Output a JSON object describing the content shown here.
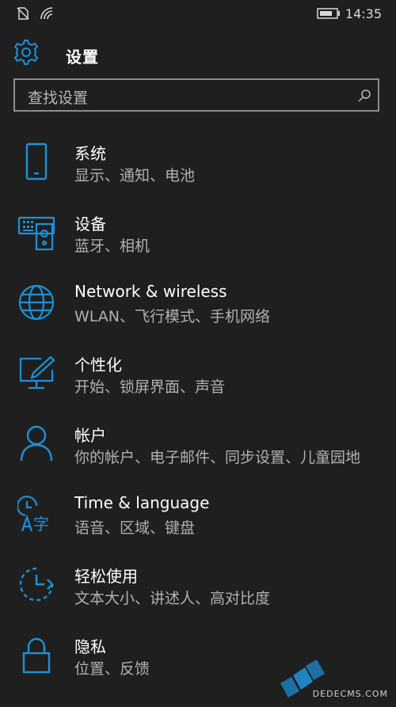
{
  "status_bar": {
    "time": "14:35",
    "icons": [
      "no-sim-icon",
      "wifi-icon",
      "battery-icon"
    ]
  },
  "header": {
    "title": "设置",
    "icon": "gear-icon"
  },
  "search": {
    "placeholder": "查找设置",
    "icon": "search-icon"
  },
  "accent_color": "#1e90d6",
  "items": [
    {
      "title": "系统",
      "subtitle": "显示、通知、电池",
      "icon": "phone-icon"
    },
    {
      "title": "设备",
      "subtitle": "蓝牙、相机",
      "icon": "devices-icon"
    },
    {
      "title": "Network & wireless",
      "subtitle": "WLAN、飞行模式、手机网络",
      "icon": "globe-icon"
    },
    {
      "title": "个性化",
      "subtitle": "开始、锁屏界面、声音",
      "icon": "personalization-icon"
    },
    {
      "title": "帐户",
      "subtitle": "你的帐户、电子邮件、同步设置、儿童园地",
      "icon": "person-icon"
    },
    {
      "title": "Time & language",
      "subtitle": "语音、区域、键盘",
      "icon": "time-language-icon"
    },
    {
      "title": "轻松使用",
      "subtitle": "文本大小、讲述人、高对比度",
      "icon": "ease-of-access-icon"
    },
    {
      "title": "隐私",
      "subtitle": "位置、反馈",
      "icon": "lock-icon"
    }
  ],
  "watermark": {
    "text": "DEDECMS.COM"
  }
}
